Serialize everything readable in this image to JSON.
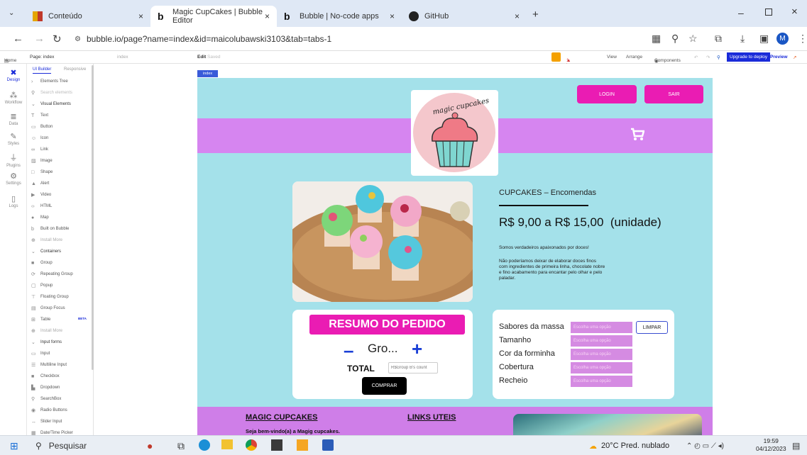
{
  "browser": {
    "tabs": [
      {
        "title": "Conteúdo",
        "close": "×"
      },
      {
        "title": "Magic CupCakes | Bubble Editor",
        "close": "×"
      },
      {
        "title": "Bubble | No-code apps",
        "close": "×"
      },
      {
        "title": "GitHub",
        "close": "×"
      }
    ],
    "new_tab": "+",
    "url": "bubble.io/page?name=index&id=maicolubawski3103&tab=tabs-1",
    "profile_initial": "M"
  },
  "editor_toolbar": {
    "home": "Home",
    "page": "Page: index",
    "index_select": "index",
    "edit": "Edit",
    "saved": "Saved",
    "issues": "1 issue",
    "view": "View",
    "arrange": "Arrange",
    "components": "Components",
    "upgrade": "Upgrade to deploy",
    "preview": "Preview"
  },
  "rail": [
    "Design",
    "Workflow",
    "Data",
    "Styles",
    "Plugins",
    "Settings",
    "Logs"
  ],
  "panel": {
    "tabs": [
      "UI Builder",
      "Responsive"
    ],
    "tree": "Elements Tree",
    "search_placeholder": "Search elements",
    "sections": [
      {
        "header": "Visual Elements",
        "items": [
          "Text",
          "Button",
          "Icon",
          "Link",
          "Image",
          "Shape",
          "Alert",
          "Video",
          "HTML",
          "Map",
          "Built on Bubble",
          "Install More"
        ]
      },
      {
        "header": "Containers",
        "items": [
          "Group",
          "Repeating Group",
          "Popup",
          "Floating Group",
          "Group Focus",
          "Table",
          "Install More"
        ]
      },
      {
        "header": "Input forms",
        "items": [
          "Input",
          "Multiline Input",
          "Checkbox",
          "Dropdown",
          "SearchBox",
          "Radio Buttons",
          "Slider Input",
          "Date/Time Picker"
        ]
      }
    ],
    "table_badge": "BETA"
  },
  "canvas": {
    "page_label": "index",
    "login": "LOGIN",
    "sair": "SAIR",
    "logo_text": "magic cupcakes",
    "product_title": "CUPCAKES – Encomendas",
    "price": "R$ 9,00 a R$ 15,00  (unidade)",
    "desc1": "Somos verdadeiros apaixonados por doces!",
    "desc2": "Não poderíamos deixar de elaborar doces finos com ingredientes de primeira linha, chocolate nobre e fino acabamento para encantar pelo olhar e pelo paladar.",
    "resumo": "RESUMO DO PEDIDO",
    "group_text": "Gro...",
    "minus": "–",
    "plus": "+",
    "total": "TOTAL",
    "total_placeholder": "R$Group B's count",
    "comprar": "COMPRAR",
    "form_labels": [
      "Sabores da massa",
      "Tamanho",
      "Cor da forminha",
      "Cobertura",
      "Recheio"
    ],
    "select_placeholder": "Escolha uma opção",
    "limpar": "LIMPAR",
    "footer_title": "MAGIC CUPCAKES",
    "footer_links": "LINKS UTEIS",
    "footer_welcome": "Seja bem-vindo(a) a Magig cupcakes."
  },
  "taskbar": {
    "search": "Pesquisar",
    "weather": "20°C  Pred. nublado",
    "time": "19:59",
    "date": "04/12/2023"
  },
  "colors": {
    "page_bg": "#a4e1ea",
    "pink": "#ea1cb3",
    "purple": "#d685f0",
    "select": "#d58be2"
  }
}
